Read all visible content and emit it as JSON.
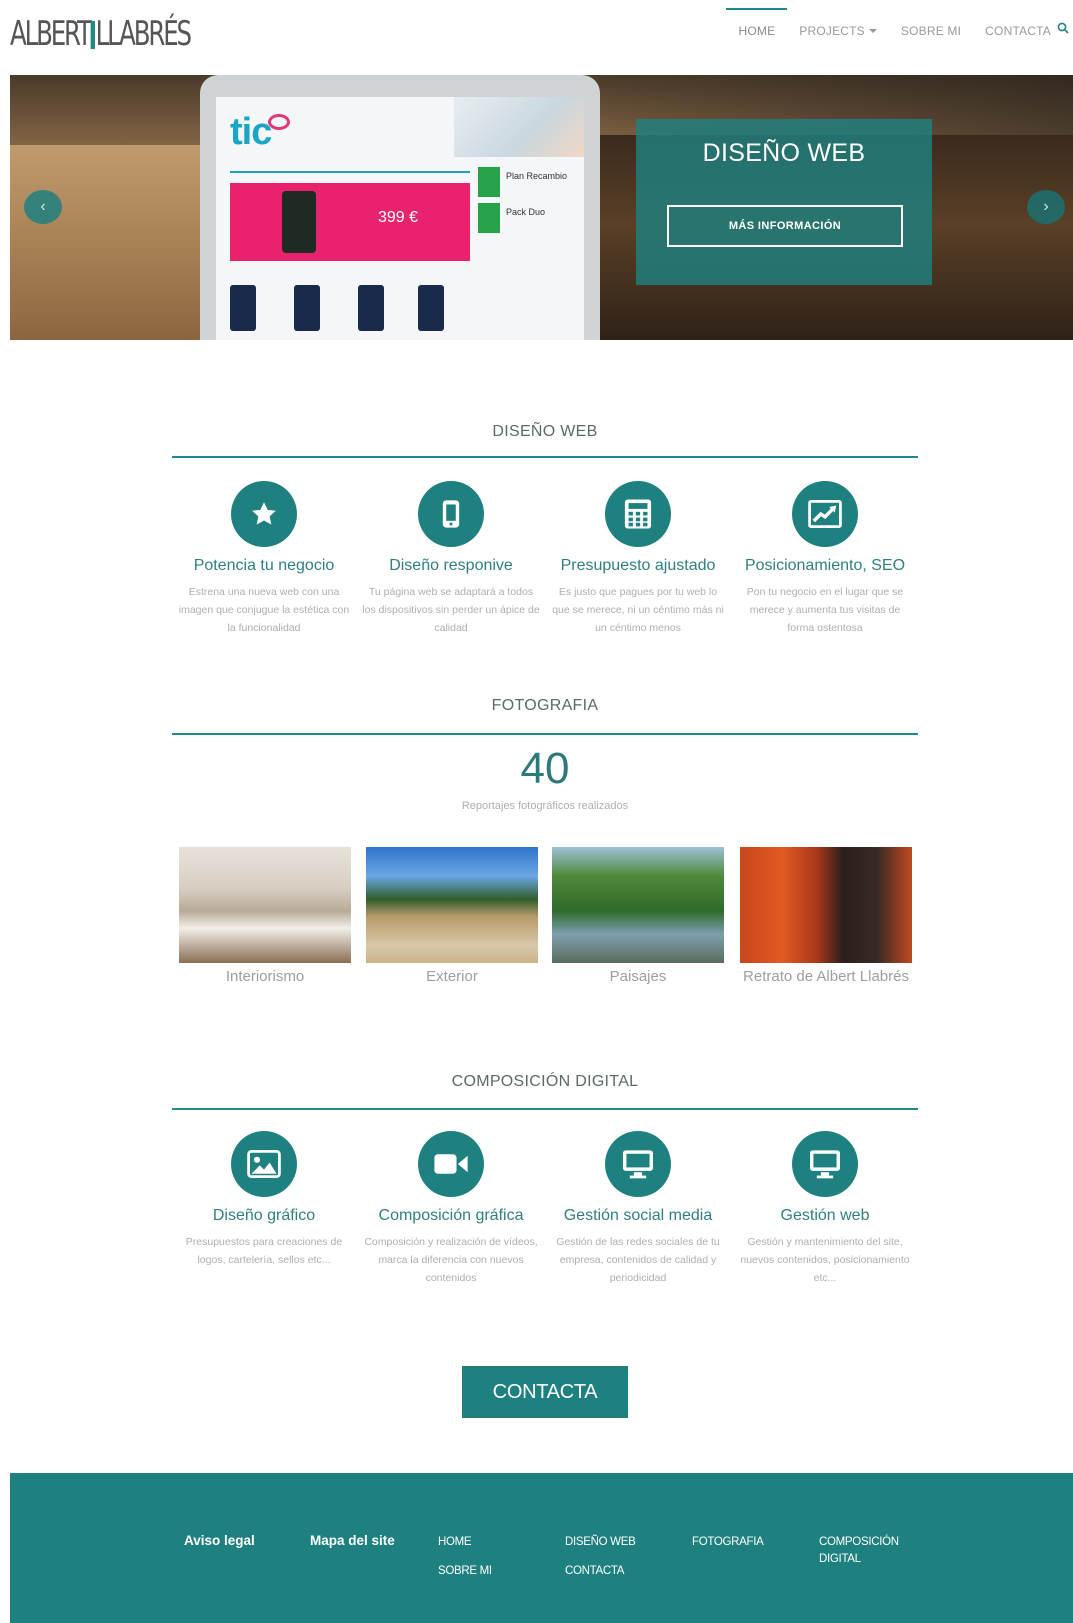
{
  "header": {
    "logo_text_a": "ALBERT",
    "logo_text_b": "LLABRÉS",
    "nav": [
      {
        "label": "HOME",
        "active": true
      },
      {
        "label": "PROJECTS",
        "dropdown": true
      },
      {
        "label": "SOBRE MI"
      },
      {
        "label": "CONTACTA"
      }
    ],
    "search_icon": "search-icon"
  },
  "hero": {
    "screen_brand": "tic",
    "screen_price": "399 €",
    "screen_side": [
      "Plan Recambio",
      "Pack Duo"
    ],
    "title": "DISEÑO WEB",
    "button": "MÁS INFORMACIÓN",
    "prev_glyph": "‹",
    "next_glyph": "›"
  },
  "diseno_web": {
    "title": "DISEÑO WEB",
    "features": [
      {
        "icon": "star-icon",
        "title": "Potencia tu negocio",
        "desc": "Estrena una nueva web con una imagen que conjugue la estética con la funcionalidad"
      },
      {
        "icon": "mobile-icon",
        "title": "Diseño responive",
        "desc": "Tu página web se adaptará a todos los dispositivos sin perder un ápice de calidad"
      },
      {
        "icon": "calculator-icon",
        "title": "Presupuesto ajustado",
        "desc": "Es justo que pagues por tu web lo que se merece, ni un céntimo más ni un céntimo menos"
      },
      {
        "icon": "chart-line-icon",
        "title": "Posicionamiento, SEO",
        "desc": "Pon tu negocio en el lugar que se merece y aumenta tus visitas de forma ostentosa"
      }
    ]
  },
  "fotografia": {
    "title": "FOTOGRAFIA",
    "count": "40",
    "count_label": "Reportajes fotográficos realizados",
    "photos": [
      {
        "caption": "Interiorismo"
      },
      {
        "caption": "Exterior"
      },
      {
        "caption": "Paisajes"
      },
      {
        "caption": "Retrato de Albert Llabrés"
      }
    ]
  },
  "composicion": {
    "title": "COMPOSICIÓN DIGITAL",
    "features": [
      {
        "icon": "image-icon",
        "title": "Diseño gráfico",
        "desc": "Presupuestos para creaciones de logos, cartelería, sellos etc..."
      },
      {
        "icon": "video-camera-icon",
        "title": "Composición gráfica",
        "desc": "Composición y realización de vídeos, marca la diferencia con nuevos contenidos"
      },
      {
        "icon": "monitor-icon",
        "title": "Gestión social media",
        "desc": "Gestión de las redes sociales de tu empresa, contenidos de calidad y periodicidad"
      },
      {
        "icon": "monitor-icon",
        "title": "Gestión web",
        "desc": "Gestión y mantenimiento del site, nuevos contenidos, posicionamiento etc..."
      }
    ]
  },
  "cta": {
    "label": "CONTACTA"
  },
  "footer": {
    "aviso": "Aviso legal",
    "mapa": "Mapa del site",
    "links": [
      {
        "label": "HOME"
      },
      {
        "label": "SOBRE MI"
      },
      {
        "label": "DISEÑO WEB"
      },
      {
        "label": "CONTACTA"
      },
      {
        "label": "FOTOGRAFIA"
      },
      {
        "label": "COMPOSICIÓN DIGITAL"
      }
    ]
  },
  "colors": {
    "accent": "#1f8080",
    "accent_light": "#2f7f7f",
    "muted_text": "#aab0b0"
  }
}
